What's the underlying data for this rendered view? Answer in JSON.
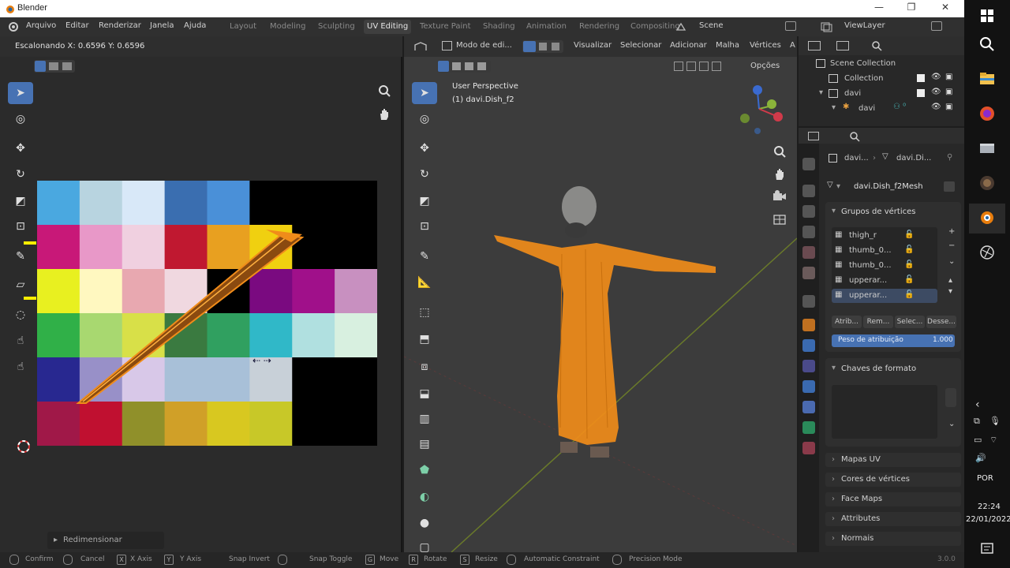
{
  "window": {
    "title": "Blender"
  },
  "menu": [
    "Arquivo",
    "Editar",
    "Renderizar",
    "Janela",
    "Ajuda"
  ],
  "workspaces": [
    "Layout",
    "Modeling",
    "Sculpting",
    "UV Editing",
    "Texture Paint",
    "Shading",
    "Animation",
    "Rendering",
    "Compositing"
  ],
  "active_workspace_index": 3,
  "scene": {
    "scene_label": "Scene",
    "viewlayer_label": "ViewLayer"
  },
  "uv_editor": {
    "header_status": "Escalonando X: 0.6596   Y: 0.6596",
    "bottom_label": "Redimensionar"
  },
  "viewport3d": {
    "mode": "Modo de edi...",
    "menus": [
      "Visualizar",
      "Selecionar",
      "Adicionar",
      "Malha",
      "Vértices",
      "A"
    ],
    "options": "Opções",
    "perspective": "User Perspective",
    "object_name": "(1) davi.Dish_f2"
  },
  "outliner": {
    "items": [
      {
        "name": "Scene Collection"
      },
      {
        "name": "Collection"
      },
      {
        "name": "davi"
      },
      {
        "name": "davi"
      }
    ]
  },
  "properties": {
    "breadcrumb_obj": "davi...",
    "breadcrumb_mesh": "davi.Di...",
    "mesh_name": "davi.Dish_f2Mesh",
    "vertex_groups_title": "Grupos de vértices",
    "vertex_groups": [
      "thigh_r",
      "thumb_0...",
      "thumb_0...",
      "upperar...",
      "upperar..."
    ],
    "vg_buttons": [
      "Atrib...",
      "Rem...",
      "Selec...",
      "Desse..."
    ],
    "weight_label": "Peso de atribuição",
    "weight_value": "1.000",
    "shape_keys_title": "Chaves de formato",
    "sections": [
      "Mapas UV",
      "Cores de vértices",
      "Face Maps",
      "Attributes",
      "Normais"
    ]
  },
  "statusbar": [
    "Confirm",
    "Cancel",
    "X Axis",
    "Y Axis",
    "Snap Invert",
    "Snap Toggle",
    "Move",
    "Rotate",
    "Resize",
    "Automatic Constraint",
    "Precision Mode"
  ],
  "statusbar_keys": [
    "X",
    "Y",
    "G",
    "R",
    "S"
  ],
  "version": "3.0.0",
  "taskbar": {
    "lang": "POR",
    "time": "22:24",
    "date": "22/01/2022"
  },
  "colors": {
    "accent": "#4772b3",
    "selection": "#f08c1a"
  }
}
